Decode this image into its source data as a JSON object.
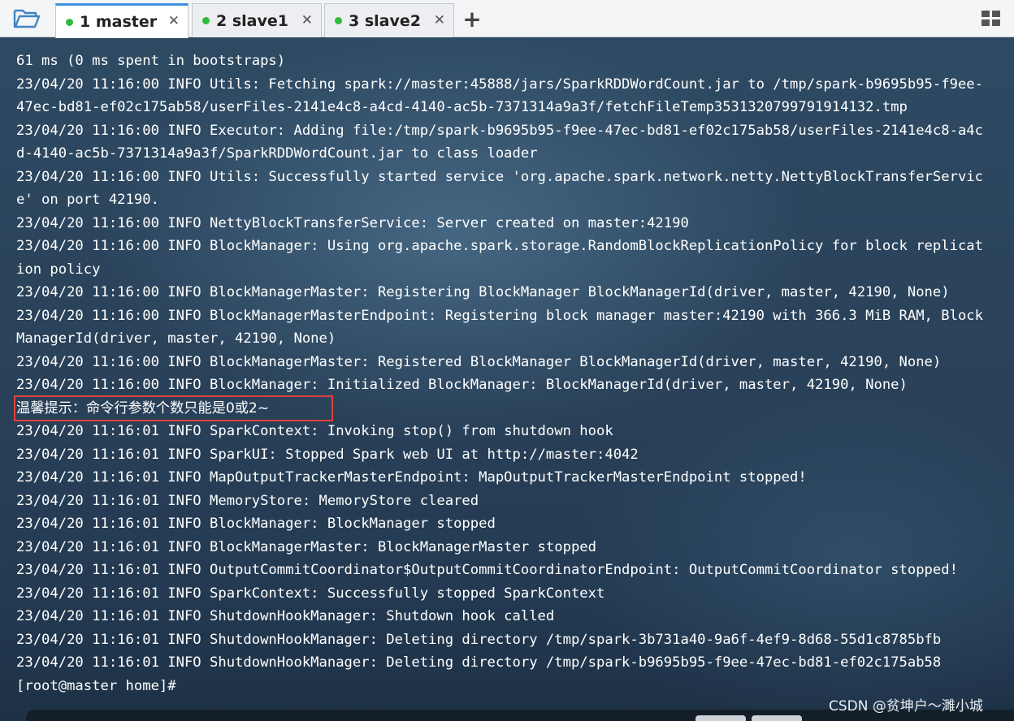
{
  "tabs": [
    {
      "label": "1 master",
      "active": true,
      "status_color": "#2ebd3a"
    },
    {
      "label": "2 slave1",
      "active": false,
      "status_color": "#2ebd3a"
    },
    {
      "label": "3 slave2",
      "active": false,
      "status_color": "#2ebd3a"
    }
  ],
  "toolbar": {
    "add_tab": "+",
    "close_glyph": "✕"
  },
  "terminal": {
    "lines": [
      "61 ms (0 ms spent in bootstraps)",
      "23/04/20 11:16:00 INFO Utils: Fetching spark://master:45888/jars/SparkRDDWordCount.jar to /tmp/spark-b9695b95-f9ee-",
      "47ec-bd81-ef02c175ab58/userFiles-2141e4c8-a4cd-4140-ac5b-7371314a9a3f/fetchFileTemp3531320799791914132.tmp",
      "23/04/20 11:16:00 INFO Executor: Adding file:/tmp/spark-b9695b95-f9ee-47ec-bd81-ef02c175ab58/userFiles-2141e4c8-a4c",
      "d-4140-ac5b-7371314a9a3f/SparkRDDWordCount.jar to class loader",
      "23/04/20 11:16:00 INFO Utils: Successfully started service 'org.apache.spark.network.netty.NettyBlockTransferServic",
      "e' on port 42190.",
      "23/04/20 11:16:00 INFO NettyBlockTransferService: Server created on master:42190",
      "23/04/20 11:16:00 INFO BlockManager: Using org.apache.spark.storage.RandomBlockReplicationPolicy for block replicat",
      "ion policy",
      "23/04/20 11:16:00 INFO BlockManagerMaster: Registering BlockManager BlockManagerId(driver, master, 42190, None)",
      "23/04/20 11:16:00 INFO BlockManagerMasterEndpoint: Registering block manager master:42190 with 366.3 MiB RAM, Block",
      "ManagerId(driver, master, 42190, None)",
      "23/04/20 11:16:00 INFO BlockManagerMaster: Registered BlockManager BlockManagerId(driver, master, 42190, None)",
      "23/04/20 11:16:00 INFO BlockManager: Initialized BlockManager: BlockManagerId(driver, master, 42190, None)",
      "温馨提示：命令行参数个数只能是0或2~",
      "23/04/20 11:16:01 INFO SparkContext: Invoking stop() from shutdown hook",
      "23/04/20 11:16:01 INFO SparkUI: Stopped Spark web UI at http://master:4042",
      "23/04/20 11:16:01 INFO MapOutputTrackerMasterEndpoint: MapOutputTrackerMasterEndpoint stopped!",
      "23/04/20 11:16:01 INFO MemoryStore: MemoryStore cleared",
      "23/04/20 11:16:01 INFO BlockManager: BlockManager stopped",
      "23/04/20 11:16:01 INFO BlockManagerMaster: BlockManagerMaster stopped",
      "23/04/20 11:16:01 INFO OutputCommitCoordinator$OutputCommitCoordinatorEndpoint: OutputCommitCoordinator stopped!",
      "23/04/20 11:16:01 INFO SparkContext: Successfully stopped SparkContext",
      "23/04/20 11:16:01 INFO ShutdownHookManager: Shutdown hook called",
      "23/04/20 11:16:01 INFO ShutdownHookManager: Deleting directory /tmp/spark-3b731a40-9a6f-4ef9-8d68-55d1c8785bfb",
      "23/04/20 11:16:01 INFO ShutdownHookManager: Deleting directory /tmp/spark-b9695b95-f9ee-47ec-bd81-ef02c175ab58"
    ],
    "prompt": "[root@master home]# ",
    "highlight_color": "#e0413a"
  },
  "watermark": "CSDN @贫坤户～濉小城",
  "icons": {
    "folder": "folder-open-icon",
    "layout": "grid-layout-icon"
  }
}
